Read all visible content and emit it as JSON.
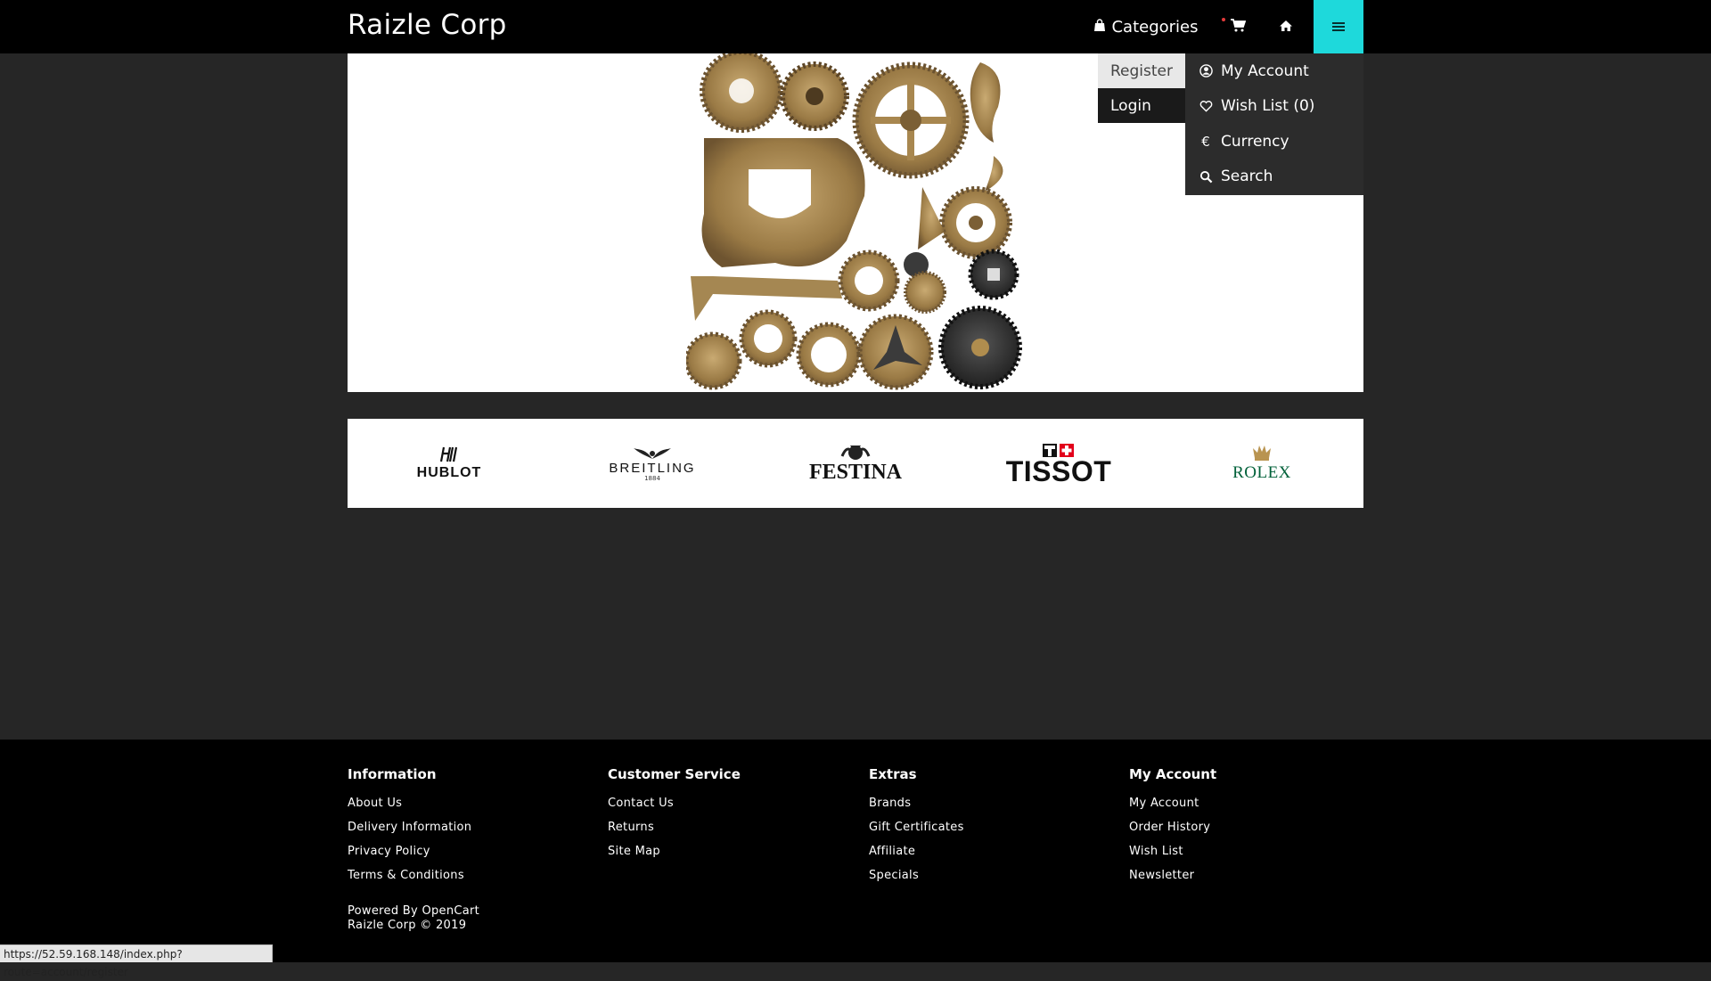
{
  "header": {
    "brand": "Raizle Corp",
    "categories_label": "Categories",
    "icons": {
      "categories": "shopping-bag-icon",
      "cart": "cart-icon",
      "home": "home-icon",
      "menu": "hamburger-menu-icon"
    }
  },
  "account_menu": {
    "left": [
      "Register",
      "Login"
    ],
    "right": [
      {
        "icon": "user-circle-icon",
        "label": "My Account"
      },
      {
        "icon": "heart-icon",
        "label": "Wish List (0)"
      },
      {
        "icon": "euro-icon",
        "label": "Currency"
      },
      {
        "icon": "search-icon",
        "label": "Search"
      }
    ]
  },
  "brands": [
    "HUBLOT",
    "BREITLING",
    "FESTINA",
    "TISSOT",
    "ROLEX"
  ],
  "brand_sub": {
    "breitling": "1884"
  },
  "footer": {
    "columns": [
      {
        "title": "Information",
        "links": [
          "About Us",
          "Delivery Information",
          "Privacy Policy",
          "Terms & Conditions"
        ]
      },
      {
        "title": "Customer Service",
        "links": [
          "Contact Us",
          "Returns",
          "Site Map"
        ]
      },
      {
        "title": "Extras",
        "links": [
          "Brands",
          "Gift Certificates",
          "Affiliate",
          "Specials"
        ]
      },
      {
        "title": "My Account",
        "links": [
          "My Account",
          "Order History",
          "Wish List",
          "Newsletter"
        ]
      }
    ],
    "powered_prefix": "Powered By",
    "powered_link": "OpenCart",
    "copyright": "Raizle Corp © 2019"
  },
  "status_url": "https://52.59.168.148/index.php?route=account/register",
  "colors": {
    "accent": "#1ed9db",
    "background": "#262626",
    "header": "#000000",
    "rolex_green": "#006039",
    "tissot_red": "#e2001a"
  }
}
